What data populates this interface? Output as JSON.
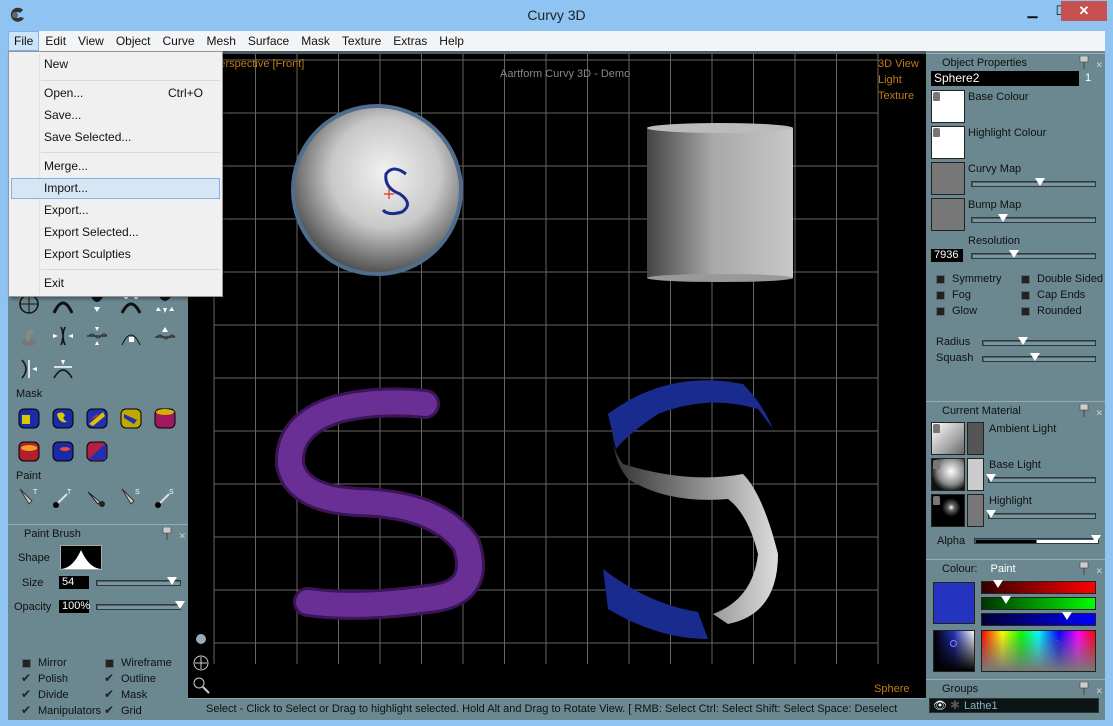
{
  "window": {
    "title": "Curvy 3D",
    "minimize": "▁",
    "maximize": "☐",
    "close": "✕"
  },
  "menubar": [
    "File",
    "Edit",
    "View",
    "Object",
    "Curve",
    "Mesh",
    "Surface",
    "Mask",
    "Texture",
    "Extras",
    "Help"
  ],
  "file_menu": {
    "items": [
      {
        "label": "New",
        "shortcut": ""
      },
      {
        "label": "Open...",
        "shortcut": "Ctrl+O"
      },
      {
        "label": "Save...",
        "shortcut": ""
      },
      {
        "label": "Save Selected...",
        "shortcut": ""
      },
      {
        "label": "Merge...",
        "shortcut": ""
      },
      {
        "label": "Import...",
        "shortcut": "",
        "highlighted": true
      },
      {
        "label": "Export...",
        "shortcut": ""
      },
      {
        "label": "Export Selected...",
        "shortcut": ""
      },
      {
        "label": "Export Sculpties",
        "shortcut": ""
      },
      {
        "label": "Exit",
        "shortcut": ""
      }
    ]
  },
  "left_panel": {
    "mask_label": "Mask",
    "paint_label": "Paint",
    "paint_brush": {
      "title": "Paint Brush",
      "shape_label": "Shape",
      "size_label": "Size",
      "size_value": "54",
      "size_slider": 0.9,
      "opacity_label": "Opacity",
      "opacity_value": "100%",
      "opacity_slider": 1.0
    },
    "checkboxes": [
      {
        "label": "Mirror",
        "checked": false
      },
      {
        "label": "Wireframe",
        "checked": false
      },
      {
        "label": "Polish",
        "checked": true
      },
      {
        "label": "Outline",
        "checked": true
      },
      {
        "label": "Divide",
        "checked": true
      },
      {
        "label": "Mask",
        "checked": true
      },
      {
        "label": "Manipulators",
        "checked": true
      },
      {
        "label": "Grid",
        "checked": true
      }
    ]
  },
  "viewport": {
    "view_label": "Perspective [Front]",
    "watermark": "Aartform Curvy 3D - Demo",
    "right_links": [
      "3D View",
      "Light",
      "Texture"
    ],
    "bottom_right": "Sphere"
  },
  "status_bar": "Select - Click to Select or Drag to highlight selected. Hold Alt and Drag to Rotate View. [ RMB: Select   Ctrl: Select   Shift: Select   Space: Deselect",
  "object_properties": {
    "title": "Object Properties",
    "name": "Sphere2",
    "index": "1",
    "base_colour": "Base Colour",
    "highlight_colour": "Highlight Colour",
    "curvy_map": "Curvy Map",
    "curvy_map_slider": 0.55,
    "bump_map": "Bump Map",
    "bump_map_slider": 0.25,
    "resolution_label": "Resolution",
    "resolution_value": "7936",
    "resolution_slider": 0.34,
    "checkboxes": [
      {
        "label": "Symmetry",
        "checked": false
      },
      {
        "label": "Double Sided",
        "checked": false
      },
      {
        "label": "Fog",
        "checked": false
      },
      {
        "label": "Cap Ends",
        "checked": false
      },
      {
        "label": "Glow",
        "checked": false
      },
      {
        "label": "Rounded",
        "checked": false
      }
    ],
    "radius_label": "Radius",
    "radius_slider": 0.36,
    "squash_label": "Squash",
    "squash_slider": 0.46
  },
  "current_material": {
    "title": "Current Material",
    "ambient": "Ambient Light",
    "base": "Base Light",
    "base_slider": 0.02,
    "highlight": "Highlight",
    "highlight_slider": 0.02,
    "alpha_label": "Alpha",
    "alpha_value": 0.98
  },
  "colour": {
    "title": "Colour:",
    "mode": "Paint",
    "swatch": "#2433c0",
    "red": 0.14,
    "green": 0.21,
    "blue": 0.75
  },
  "groups": {
    "title": "Groups",
    "items": [
      {
        "name": "Lathe1"
      }
    ]
  }
}
